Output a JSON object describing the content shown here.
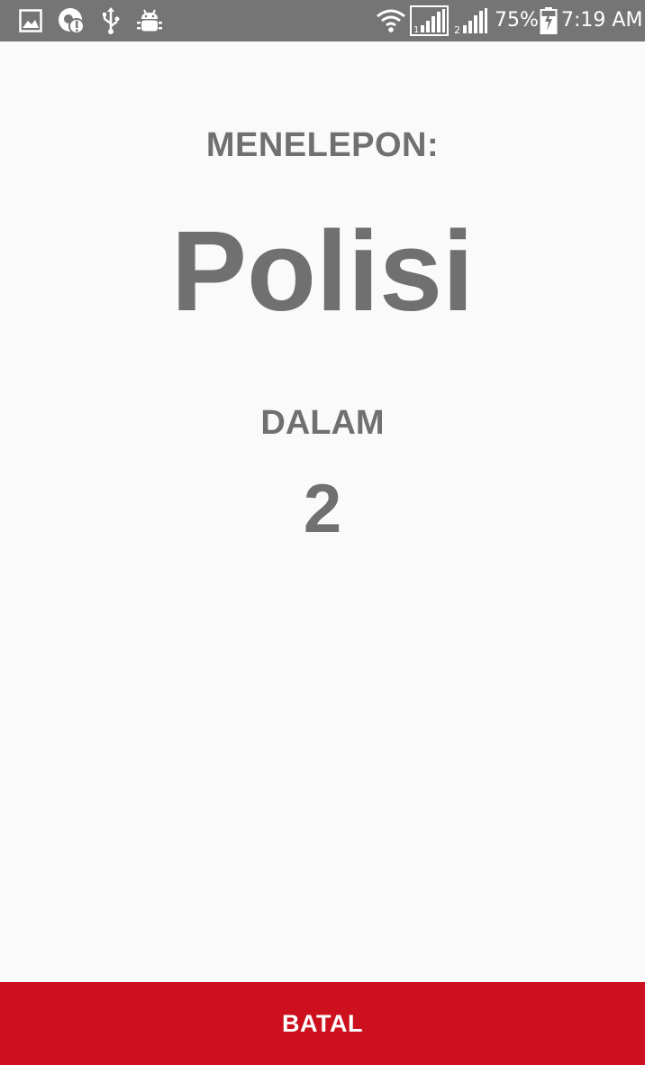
{
  "status_bar": {
    "background": "#757575",
    "left_icons": [
      "image-notification-icon",
      "sync-alert-icon",
      "usb-icon",
      "android-debug-icon"
    ],
    "right_icons": [
      "wifi-icon",
      "sim1-signal-icon",
      "sim2-signal-icon",
      "battery-charging-icon"
    ],
    "sim1_label": "1",
    "sim2_label": "2",
    "battery_percent": "75%",
    "time": "7:19 AM"
  },
  "call_screen": {
    "calling_label": "MENELEPON:",
    "target_name": "Polisi",
    "within_label": "DALAM",
    "countdown": "2",
    "text_color": "#707070",
    "background": "#fafafa"
  },
  "cancel_button": {
    "label": "BATAL",
    "background": "#cd101e",
    "text_color": "#ffffff"
  }
}
